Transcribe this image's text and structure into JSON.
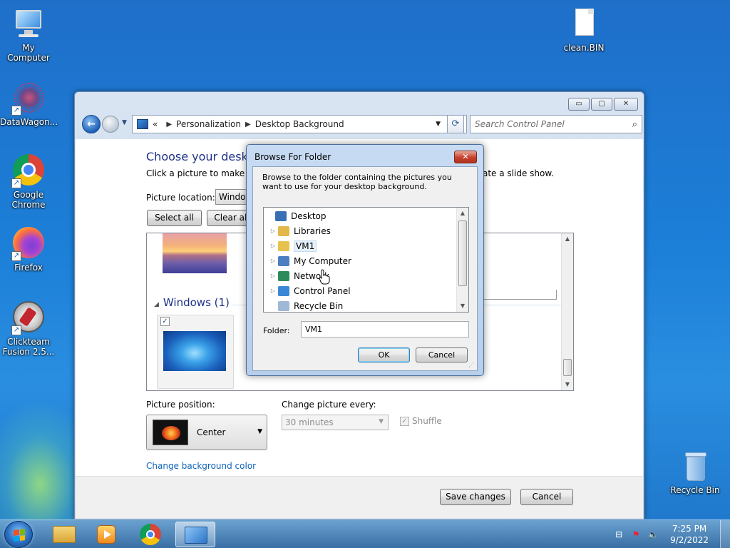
{
  "desktop": {
    "icons": [
      {
        "label": "My Computer",
        "icon": "computer-icon"
      },
      {
        "label": "DataWagon...",
        "icon": "datawagon-icon"
      },
      {
        "label": "Google Chrome",
        "icon": "chrome-icon"
      },
      {
        "label": "Firefox",
        "icon": "firefox-icon"
      },
      {
        "label": "Clickteam Fusion 2.5...",
        "icon": "clickteam-icon"
      },
      {
        "label": "clean.BIN",
        "icon": "file-icon"
      },
      {
        "label": "Recycle Bin",
        "icon": "recycle-bin-icon"
      }
    ],
    "icon_lines": {
      "chrome": [
        "Google",
        "Chrome"
      ],
      "clickteam": [
        "Clickteam",
        "Fusion 2.5..."
      ]
    }
  },
  "window": {
    "controls": {
      "minimize": "▭",
      "maximize": "▢",
      "close": "✕"
    },
    "address": {
      "crumb_prefix": "«",
      "crumbs": [
        "Personalization",
        "Desktop Background"
      ],
      "separator": "▶"
    },
    "search_placeholder": "Search Control Panel",
    "heading": "Choose your desktop",
    "intro": "Click a picture to make it y",
    "intro_tail": "ate a slide show.",
    "picture_location_label": "Picture location:",
    "picture_location_value": "Window",
    "select_all": "Select all",
    "clear_all": "Clear all",
    "group_title": "Windows (1)",
    "tile_checked": "✓",
    "picture_position_label": "Picture position:",
    "picture_position_value": "Center",
    "change_every_label": "Change picture every:",
    "change_every_value": "30 minutes",
    "shuffle_label": "Shuffle",
    "change_bg_color": "Change background color",
    "save_changes": "Save changes",
    "cancel": "Cancel"
  },
  "dialog": {
    "title": "Browse For Folder",
    "close": "✕",
    "description": "Browse to the folder containing the pictures you want to use for your desktop background.",
    "tree": [
      {
        "label": "Desktop",
        "expander": "",
        "icon": "desktop-icon",
        "color": "#3a6fb5"
      },
      {
        "label": "Libraries",
        "expander": "▷",
        "icon": "libraries-icon",
        "color": "#e2b84a"
      },
      {
        "label": "VM1",
        "expander": "▷",
        "icon": "user-folder-icon",
        "color": "#e8c24e"
      },
      {
        "label": "My Computer",
        "expander": "▷",
        "icon": "computer-icon",
        "color": "#4b7fc2"
      },
      {
        "label": "Network",
        "expander": "▷",
        "icon": "network-icon",
        "color": "#2d8a5a"
      },
      {
        "label": "Control Panel",
        "expander": "▷",
        "icon": "control-panel-icon",
        "color": "#3b86d6"
      },
      {
        "label": "Recycle Bin",
        "expander": "",
        "icon": "recycle-bin-icon",
        "color": "#9fb8d6"
      }
    ],
    "selected_index": 2,
    "folder_label": "Folder:",
    "folder_value": "VM1",
    "ok": "OK",
    "cancel": "Cancel"
  },
  "taskbar": {
    "buttons": [
      "explorer-icon",
      "media-player-icon",
      "chrome-icon",
      "control-panel-icon"
    ],
    "time": "7:25 PM",
    "date": "9/2/2022"
  },
  "colors": {
    "accent": "#1e3287",
    "link": "#0d63b8",
    "desktop": "#1f6fc9"
  }
}
